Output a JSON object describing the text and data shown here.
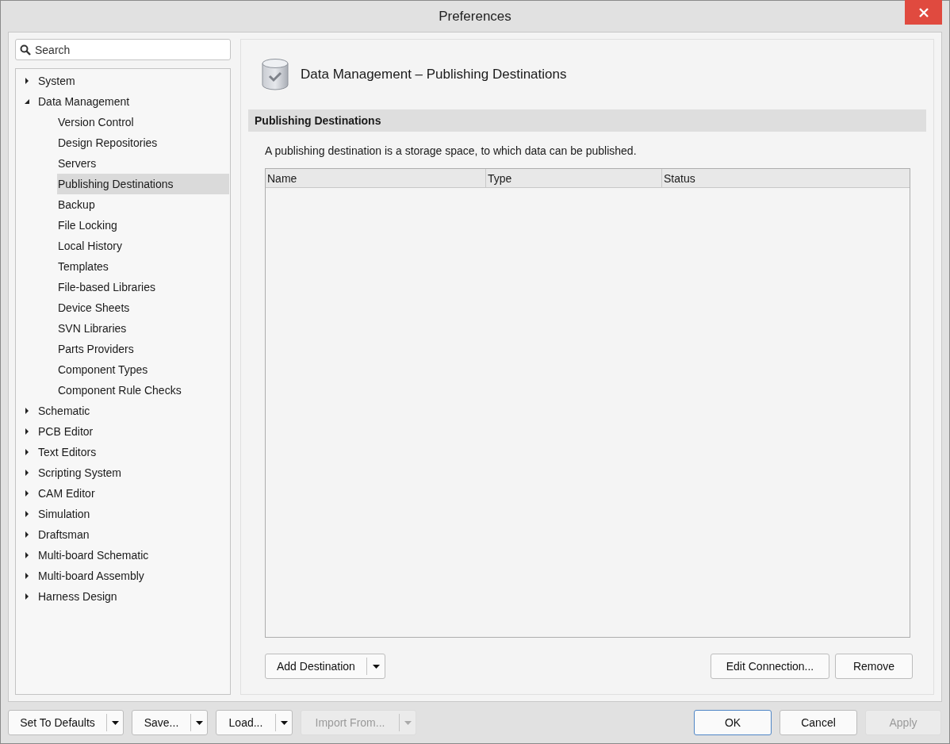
{
  "window": {
    "title": "Preferences"
  },
  "sidebar": {
    "search": {
      "placeholder": "Search"
    },
    "tree": [
      {
        "label": "System",
        "expanded": false,
        "selected": false
      },
      {
        "label": "Data Management",
        "expanded": true,
        "selected": false,
        "children": [
          {
            "label": "Version Control",
            "selected": false
          },
          {
            "label": "Design Repositories",
            "selected": false
          },
          {
            "label": "Servers",
            "selected": false
          },
          {
            "label": "Publishing Destinations",
            "selected": true
          },
          {
            "label": "Backup",
            "selected": false
          },
          {
            "label": "File Locking",
            "selected": false
          },
          {
            "label": "Local History",
            "selected": false
          },
          {
            "label": "Templates",
            "selected": false
          },
          {
            "label": "File-based Libraries",
            "selected": false
          },
          {
            "label": "Device Sheets",
            "selected": false
          },
          {
            "label": "SVN Libraries",
            "selected": false
          },
          {
            "label": "Parts Providers",
            "selected": false
          },
          {
            "label": "Component Types",
            "selected": false
          },
          {
            "label": "Component Rule Checks",
            "selected": false
          }
        ]
      },
      {
        "label": "Schematic",
        "expanded": false,
        "selected": false
      },
      {
        "label": "PCB Editor",
        "expanded": false,
        "selected": false
      },
      {
        "label": "Text Editors",
        "expanded": false,
        "selected": false
      },
      {
        "label": "Scripting System",
        "expanded": false,
        "selected": false
      },
      {
        "label": "CAM Editor",
        "expanded": false,
        "selected": false
      },
      {
        "label": "Simulation",
        "expanded": false,
        "selected": false
      },
      {
        "label": "Draftsman",
        "expanded": false,
        "selected": false
      },
      {
        "label": "Multi-board Schematic",
        "expanded": false,
        "selected": false
      },
      {
        "label": "Multi-board Assembly",
        "expanded": false,
        "selected": false
      },
      {
        "label": "Harness Design",
        "expanded": false,
        "selected": false
      }
    ]
  },
  "page": {
    "title": "Data Management – Publishing Destinations",
    "section": "Publishing Destinations",
    "description": "A publishing destination is a storage space, to which data can be published.",
    "table": {
      "columns": [
        "Name",
        "Type",
        "Status"
      ]
    },
    "buttons": [
      {
        "label": "Add Destination",
        "kind": "split"
      },
      {
        "label": "Edit Connection...",
        "kind": "plain"
      },
      {
        "label": "Remove",
        "kind": "plain"
      }
    ]
  },
  "footer": {
    "buttons": [
      {
        "label": "Set To Defaults",
        "kind": "split",
        "disabled": false,
        "default": false
      },
      {
        "label": "Save...",
        "kind": "split",
        "disabled": false,
        "default": false
      },
      {
        "label": "Load...",
        "kind": "split",
        "disabled": false,
        "default": false
      },
      {
        "label": "Import From...",
        "kind": "split",
        "disabled": true,
        "default": false
      },
      {
        "label": "OK",
        "kind": "plain",
        "disabled": false,
        "default": true
      },
      {
        "label": "Cancel",
        "kind": "plain",
        "disabled": false,
        "default": false
      },
      {
        "label": "Apply",
        "kind": "plain",
        "disabled": true,
        "default": false
      }
    ]
  }
}
